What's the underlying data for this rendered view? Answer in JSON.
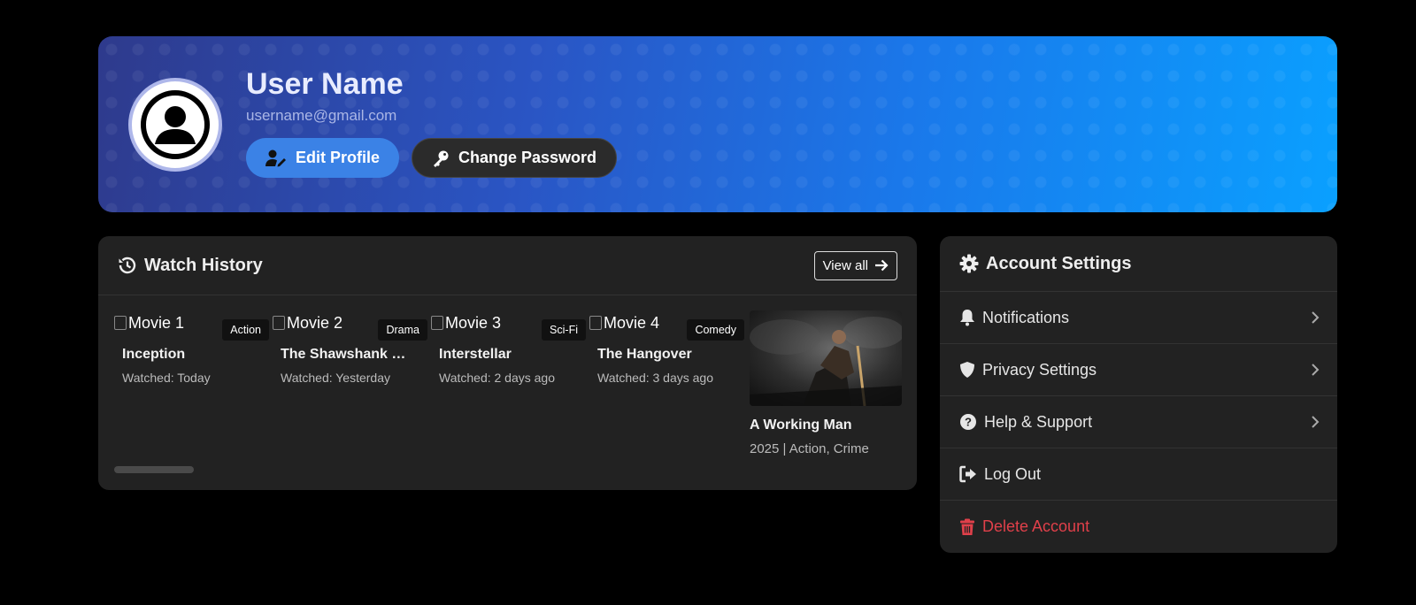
{
  "profile": {
    "name": "User Name",
    "email": "username@gmail.com",
    "edit_label": "Edit Profile",
    "password_label": "Change Password"
  },
  "history": {
    "title": "Watch History",
    "view_all": "View all",
    "movies": [
      {
        "alt": "Movie 1",
        "genre": "Action",
        "title": "Inception",
        "watched": "Watched: Today"
      },
      {
        "alt": "Movie 2",
        "genre": "Drama",
        "title": "The Shawshank Re...",
        "watched": "Watched: Yesterday"
      },
      {
        "alt": "Movie 3",
        "genre": "Sci-Fi",
        "title": "Interstellar",
        "watched": "Watched: 2 days ago"
      },
      {
        "alt": "Movie 4",
        "genre": "Comedy",
        "title": "The Hangover",
        "watched": "Watched: 3 days ago"
      }
    ],
    "featured": {
      "title": "A Working Man",
      "meta": "2025 | Action, Crime"
    }
  },
  "settings": {
    "title": "Account Settings",
    "items": [
      {
        "label": "Notifications",
        "icon": "bell-icon"
      },
      {
        "label": "Privacy Settings",
        "icon": "shield-icon"
      },
      {
        "label": "Help & Support",
        "icon": "question-circle-icon"
      },
      {
        "label": "Log Out",
        "icon": "sign-out-icon"
      },
      {
        "label": "Delete Account",
        "icon": "trash-icon"
      }
    ]
  },
  "colors": {
    "accent": "#3b82e6",
    "danger": "#e0404a",
    "panel": "#222222"
  }
}
